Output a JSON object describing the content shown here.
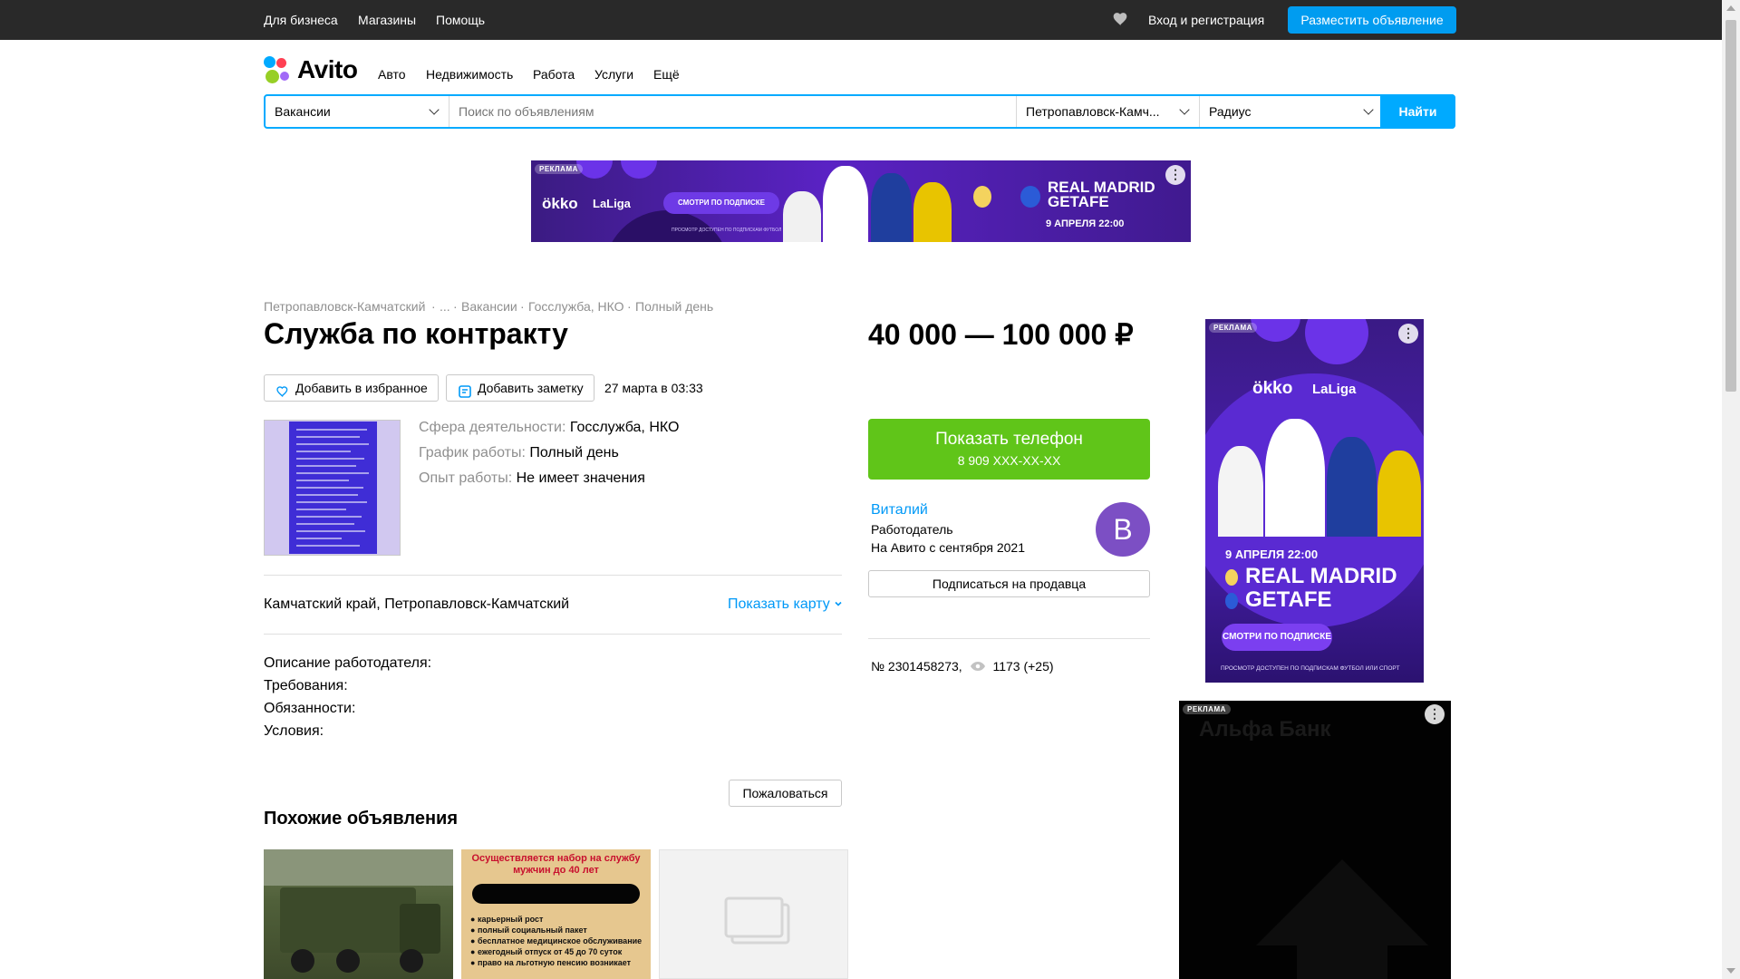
{
  "topbar": {
    "for_business": "Для бизнеса",
    "shops": "Магазины",
    "help": "Помощь",
    "login": "Вход и регистрация",
    "post_ad": "Разместить объявление"
  },
  "header": {
    "logo_text": "Avito",
    "nav": [
      "Авто",
      "Недвижимость",
      "Работа",
      "Услуги",
      "Ещё"
    ]
  },
  "search": {
    "category": "Вакансии",
    "placeholder": "Поиск по объявлениям",
    "city": "Петропавловск-Камч...",
    "radius": "Радиус",
    "button": "Найти"
  },
  "banner_ad": {
    "tag": "РЕКЛАМА",
    "brand": "ökko",
    "league": "LaLiga",
    "cta": "СМОТРИ ПО ПОДПИСКЕ",
    "fine_print": "ПРОСМОТР ДОСТУПЕН ПО ПОДПИСКАМ ФУТБОЛ ИЛИ СПОРТ",
    "match_line1": "REAL MADRID",
    "match_line2": "GETAFE",
    "date": "9 АПРЕЛЯ 22:00"
  },
  "breadcrumbs": [
    "Петропавловск-Камчатский",
    "...",
    "Вакансии",
    "Госслужба, НКО",
    "Полный день"
  ],
  "listing": {
    "title": "Служба по контракту",
    "price": "40 000 — 100 000 ₽",
    "add_favorite": "Добавить в избранное",
    "add_note": "Добавить заметку",
    "date": "27 марта в 03:33",
    "params": [
      {
        "label": "Сфера деятельности:",
        "value": "Госслужба, НКО"
      },
      {
        "label": "График работы:",
        "value": "Полный день"
      },
      {
        "label": "Опыт работы:",
        "value": "Не имеет значения"
      }
    ],
    "address": "Камчатский край, Петропавловск-Камчатский",
    "show_map": "Показать карту",
    "description": [
      "Описание работодателя:",
      "Требования:",
      "Обязанности:",
      "Условия:"
    ],
    "complain": "Пожаловаться",
    "similar_title": "Похожие объявления"
  },
  "similar_card2": {
    "line1": "Осуществляется набор на службу",
    "line2": "мужчин до 40 лет",
    "bullets": [
      "карьерный рост",
      "полный социальный пакет",
      "бесплатное медицинское обслуживание",
      "ежегодный отпуск от 45 до 70 суток",
      "право на льготную пенсию возникает"
    ]
  },
  "seller": {
    "phone_label": "Показать телефон",
    "phone_masked": "8 909 XXX-XX-XX",
    "name": "Виталий",
    "role": "Работодатель",
    "since": "На Авито с сентября 2021",
    "avatar_letter": "В",
    "subscribe": "Подписаться на продавца"
  },
  "meta": {
    "id": "№ 2301458273,",
    "views": "1173 (+25)"
  },
  "side_ad": {
    "tag": "РЕКЛАМА",
    "brand": "ökko",
    "league": "LaLiga",
    "date": "9 АПРЕЛЯ 22:00",
    "match_line1": "REAL MADRID",
    "match_line2": "GETAFE",
    "cta": "СМОТРИ ПО ПОДПИСКЕ",
    "fine_print": "ПРОСМОТР ДОСТУПЕН ПО ПОДПИСКАМ ФУТБОЛ ИЛИ СПОРТ"
  },
  "alfa_ad": {
    "tag": "РЕКЛАМА",
    "title": "Альфа Банк"
  },
  "colors": {
    "topbar": "#292929",
    "accent_blue": "#00aaff",
    "phone_green": "#60c519",
    "link_blue": "#0099f7",
    "avatar": "#7c4fc4"
  }
}
